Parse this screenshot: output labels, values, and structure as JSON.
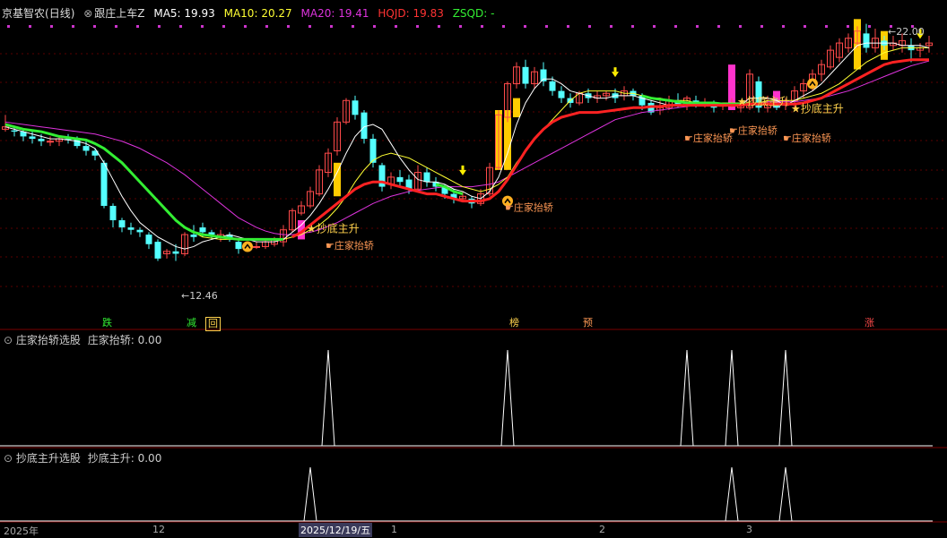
{
  "header": {
    "stock_name": "京基智农",
    "period": "(日线)",
    "indicator": "跟庄上车Z",
    "ma5_label": "MA5:",
    "ma5_value": "19.93",
    "ma10_label": "MA10:",
    "ma10_value": "20.27",
    "ma20_label": "MA20:",
    "ma20_value": "19.41",
    "hqjd_label": "HQJD:",
    "hqjd_value": "19.83",
    "zsqd_label": "ZSQD:",
    "zsqd_value": "-"
  },
  "price_labels": {
    "high": "22.00",
    "low": "12.46"
  },
  "signals": {
    "zhuangjia": "庄家抬轿",
    "chaodi": "抄底主升"
  },
  "bottom_tags": [
    "跌",
    "减",
    "回",
    "榜",
    "预",
    "涨"
  ],
  "panel2": {
    "title": "庄家抬轿选股",
    "series_label": "庄家抬轿:",
    "value": "0.00"
  },
  "panel3": {
    "title": "抄底主升选股",
    "series_label": "抄底主升:",
    "value": "0.00"
  },
  "date_axis": {
    "left": "2025年",
    "month_12": "12",
    "cursor_date": "2025/12/19/五",
    "month_1": "1",
    "mark_a": "2",
    "mark_b": "3"
  },
  "colors": {
    "bg": "#000000",
    "up": "#ff4a4a",
    "down": "#54ffff",
    "ma5": "#ffffff",
    "ma10": "#ffff33",
    "ma20": "#dd33dd",
    "hqjd": "#ff2222",
    "green_line": "#33ee33",
    "signal_gold": "#ffd24d"
  },
  "chart_data": {
    "type": "candlestick",
    "ylim": [
      11.5,
      23.5
    ],
    "candles": [
      [
        19.0,
        19.1,
        18.9,
        19.6
      ],
      [
        18.95,
        18.9,
        18.7,
        19.1
      ],
      [
        18.9,
        18.7,
        18.5,
        19.0
      ],
      [
        18.7,
        18.6,
        18.4,
        18.9
      ],
      [
        18.6,
        18.5,
        18.3,
        18.8
      ],
      [
        18.5,
        18.5,
        18.3,
        18.7
      ],
      [
        18.5,
        18.6,
        18.3,
        18.7
      ],
      [
        18.6,
        18.55,
        18.4,
        18.8
      ],
      [
        18.6,
        18.3,
        18.2,
        18.7
      ],
      [
        18.3,
        18.1,
        17.9,
        18.5
      ],
      [
        18.1,
        17.9,
        17.7,
        18.2
      ],
      [
        17.6,
        15.8,
        15.7,
        17.7
      ],
      [
        15.8,
        15.2,
        14.9,
        15.9
      ],
      [
        15.2,
        14.9,
        14.7,
        15.3
      ],
      [
        14.9,
        14.8,
        14.6,
        15.1
      ],
      [
        14.8,
        14.7,
        14.5,
        14.9
      ],
      [
        14.6,
        14.2,
        14.0,
        14.7
      ],
      [
        14.3,
        13.6,
        13.5,
        14.4
      ],
      [
        13.8,
        13.9,
        13.6,
        14.0
      ],
      [
        13.9,
        13.8,
        13.5,
        14.2
      ],
      [
        13.8,
        14.6,
        13.7,
        14.7
      ],
      [
        14.6,
        14.5,
        14.3,
        15.0
      ],
      [
        14.9,
        14.7,
        14.5,
        15.1
      ],
      [
        14.7,
        14.6,
        14.4,
        14.8
      ],
      [
        14.5,
        14.6,
        14.3,
        14.8
      ],
      [
        14.6,
        14.4,
        14.3,
        14.7
      ],
      [
        14.3,
        14.0,
        13.8,
        14.4
      ],
      [
        14.0,
        14.2,
        13.9,
        14.3
      ],
      [
        14.1,
        14.1,
        14.0,
        14.3
      ],
      [
        14.1,
        14.3,
        14.0,
        14.4
      ],
      [
        14.2,
        14.4,
        14.1,
        14.5
      ],
      [
        14.3,
        14.8,
        14.1,
        15.0
      ],
      [
        14.8,
        15.6,
        14.7,
        15.7
      ],
      [
        15.5,
        15.8,
        15.4,
        16.0
      ],
      [
        15.8,
        16.4,
        15.7,
        16.6
      ],
      [
        16.3,
        17.3,
        16.2,
        17.5
      ],
      [
        17.2,
        18.0,
        17.0,
        18.2
      ],
      [
        18.1,
        19.3,
        17.9,
        19.5
      ],
      [
        19.3,
        20.2,
        19.2,
        20.3
      ],
      [
        20.2,
        19.6,
        19.4,
        20.4
      ],
      [
        19.7,
        18.6,
        18.4,
        19.8
      ],
      [
        18.6,
        17.6,
        17.4,
        18.8
      ],
      [
        17.5,
        16.6,
        16.4,
        17.6
      ],
      [
        16.7,
        17.0,
        16.5,
        17.2
      ],
      [
        17.0,
        16.8,
        16.6,
        17.3
      ],
      [
        16.9,
        16.5,
        16.3,
        17.1
      ],
      [
        16.5,
        17.2,
        16.4,
        17.5
      ],
      [
        17.2,
        16.8,
        16.6,
        17.4
      ],
      [
        16.8,
        16.6,
        16.4,
        17.0
      ],
      [
        16.6,
        16.3,
        16.1,
        16.7
      ],
      [
        16.3,
        16.1,
        15.9,
        16.5
      ],
      [
        16.1,
        16.2,
        16.0,
        16.4
      ],
      [
        16.1,
        15.9,
        15.7,
        16.2
      ],
      [
        15.9,
        16.3,
        15.8,
        16.5
      ],
      [
        16.3,
        17.4,
        16.2,
        17.6
      ],
      [
        17.4,
        19.6,
        17.3,
        19.8
      ],
      [
        19.5,
        20.9,
        19.3,
        21.0
      ],
      [
        20.9,
        21.6,
        20.7,
        21.8
      ],
      [
        21.6,
        20.9,
        20.7,
        21.9
      ],
      [
        20.9,
        21.4,
        20.7,
        21.6
      ],
      [
        21.5,
        21.0,
        20.8,
        21.8
      ],
      [
        21.0,
        20.6,
        20.4,
        21.2
      ],
      [
        20.6,
        20.3,
        20.1,
        20.8
      ],
      [
        20.3,
        20.1,
        19.9,
        20.5
      ],
      [
        20.1,
        20.5,
        20.0,
        20.6
      ],
      [
        20.5,
        20.3,
        20.1,
        20.7
      ],
      [
        20.3,
        20.4,
        20.1,
        20.6
      ],
      [
        20.4,
        20.5,
        20.2,
        20.6
      ],
      [
        20.5,
        20.3,
        20.1,
        20.7
      ],
      [
        20.4,
        20.6,
        20.2,
        20.8
      ],
      [
        20.6,
        20.4,
        20.2,
        20.7
      ],
      [
        20.4,
        20.0,
        19.8,
        20.5
      ],
      [
        20.1,
        19.7,
        19.6,
        20.2
      ],
      [
        19.8,
        19.9,
        19.6,
        20.3
      ],
      [
        19.9,
        20.2,
        19.8,
        20.4
      ],
      [
        20.2,
        20.0,
        19.9,
        20.5
      ],
      [
        20.0,
        20.3,
        19.8,
        20.4
      ],
      [
        20.2,
        20.1,
        19.9,
        20.4
      ],
      [
        20.0,
        20.1,
        19.9,
        20.3
      ],
      [
        20.0,
        19.9,
        19.7,
        20.2
      ],
      [
        20.0,
        20.0,
        19.8,
        20.1
      ],
      [
        20.0,
        20.1,
        19.9,
        20.3
      ],
      [
        19.9,
        20.0,
        19.7,
        20.2
      ],
      [
        19.9,
        21.3,
        19.8,
        21.5
      ],
      [
        21.0,
        19.9,
        19.7,
        21.2
      ],
      [
        19.9,
        20.1,
        19.7,
        20.4
      ],
      [
        20.1,
        19.9,
        19.8,
        20.3
      ],
      [
        20.0,
        20.1,
        19.8,
        20.3
      ],
      [
        20.2,
        20.6,
        19.9,
        20.8
      ],
      [
        20.6,
        20.9,
        20.3,
        21.1
      ],
      [
        20.8,
        21.3,
        20.6,
        21.5
      ],
      [
        21.3,
        21.7,
        21.0,
        21.9
      ],
      [
        21.6,
        22.3,
        21.5,
        22.5
      ],
      [
        22.0,
        22.6,
        21.8,
        22.8
      ],
      [
        22.4,
        22.8,
        22.2,
        23.0
      ],
      [
        22.6,
        23.1,
        22.4,
        23.3
      ],
      [
        23.0,
        22.4,
        22.2,
        23.4
      ],
      [
        22.4,
        22.8,
        22.2,
        23.2
      ],
      [
        22.7,
        22.5,
        22.3,
        22.9
      ],
      [
        22.5,
        22.6,
        22.3,
        22.9
      ],
      [
        22.5,
        22.7,
        22.2,
        23.0
      ],
      [
        22.5,
        22.3,
        21.8,
        22.8
      ],
      [
        22.3,
        22.4,
        22.0,
        22.6
      ],
      [
        22.5,
        22.6,
        22.2,
        22.9
      ]
    ],
    "ma5": [
      19.1,
      19.0,
      18.9,
      18.8,
      18.7,
      18.6,
      18.6,
      18.55,
      18.5,
      18.4,
      18.2,
      17.6,
      16.9,
      16.2,
      15.6,
      15.1,
      14.8,
      14.5,
      14.3,
      14.1,
      14.0,
      14.1,
      14.3,
      14.4,
      14.5,
      14.6,
      14.5,
      14.4,
      14.3,
      14.3,
      14.3,
      14.4,
      14.7,
      15.0,
      15.4,
      15.9,
      16.5,
      17.2,
      18.0,
      18.7,
      19.1,
      19.2,
      19.0,
      18.4,
      17.8,
      17.3,
      16.9,
      16.8,
      16.8,
      16.7,
      16.5,
      16.4,
      16.2,
      16.1,
      16.4,
      17.0,
      18.0,
      19.2,
      20.1,
      20.7,
      21.1,
      21.1,
      20.9,
      20.6,
      20.5,
      20.4,
      20.3,
      20.3,
      20.4,
      20.4,
      20.4,
      20.3,
      20.2,
      20.1,
      20.0,
      20.0,
      20.0,
      20.1,
      20.1,
      20.1,
      20.0,
      20.0,
      20.0,
      20.3,
      20.3,
      20.3,
      20.2,
      20.0,
      20.2,
      20.4,
      20.6,
      20.9,
      21.3,
      21.7,
      22.1,
      22.5,
      22.6,
      22.6,
      22.6,
      22.6,
      22.5,
      22.5,
      22.5,
      22.4
    ],
    "ma10": [
      19.2,
      19.1,
      19.0,
      18.95,
      18.9,
      18.8,
      18.7,
      18.65,
      18.6,
      18.55,
      18.4,
      18.2,
      17.9,
      17.6,
      17.2,
      16.8,
      16.4,
      16.0,
      15.6,
      15.2,
      14.9,
      14.7,
      14.5,
      14.45,
      14.4,
      14.4,
      14.4,
      14.4,
      14.4,
      14.4,
      14.4,
      14.4,
      14.5,
      14.6,
      14.8,
      15.0,
      15.3,
      15.7,
      16.2,
      16.8,
      17.3,
      17.7,
      17.9,
      18.0,
      17.9,
      17.8,
      17.6,
      17.4,
      17.2,
      17.0,
      16.8,
      16.6,
      16.5,
      16.4,
      16.5,
      16.7,
      17.0,
      17.6,
      18.1,
      18.6,
      19.0,
      19.4,
      19.8,
      20.2,
      20.5,
      20.6,
      20.6,
      20.6,
      20.6,
      20.5,
      20.5,
      20.4,
      20.3,
      20.3,
      20.2,
      20.2,
      20.2,
      20.1,
      20.1,
      20.1,
      20.1,
      20.1,
      20.1,
      20.1,
      20.1,
      20.2,
      20.2,
      20.2,
      20.2,
      20.3,
      20.4,
      20.5,
      20.7,
      20.9,
      21.2,
      21.5,
      21.8,
      22.0,
      22.2,
      22.3,
      22.4,
      22.4,
      22.4,
      22.4
    ],
    "ma20": [
      19.3,
      19.25,
      19.2,
      19.15,
      19.1,
      19.05,
      19.0,
      18.95,
      18.9,
      18.85,
      18.8,
      18.7,
      18.6,
      18.5,
      18.35,
      18.2,
      18.0,
      17.8,
      17.6,
      17.35,
      17.1,
      16.8,
      16.5,
      16.2,
      15.9,
      15.6,
      15.3,
      15.1,
      14.9,
      14.75,
      14.65,
      14.6,
      14.6,
      14.65,
      14.7,
      14.8,
      14.95,
      15.1,
      15.3,
      15.5,
      15.7,
      15.9,
      16.05,
      16.2,
      16.3,
      16.4,
      16.45,
      16.5,
      16.55,
      16.6,
      16.6,
      16.6,
      16.6,
      16.65,
      16.7,
      16.8,
      17.0,
      17.2,
      17.4,
      17.6,
      17.8,
      18.0,
      18.2,
      18.4,
      18.6,
      18.8,
      19.0,
      19.2,
      19.4,
      19.5,
      19.6,
      19.7,
      19.75,
      19.8,
      19.85,
      19.9,
      19.95,
      20.0,
      20.0,
      20.05,
      20.05,
      20.1,
      20.1,
      20.1,
      20.1,
      20.15,
      20.15,
      20.15,
      20.15,
      20.2,
      20.25,
      20.3,
      20.4,
      20.5,
      20.6,
      20.75,
      20.9,
      21.05,
      21.2,
      21.35,
      21.5,
      21.65,
      21.75,
      21.85
    ],
    "hqjd": [
      null,
      null,
      null,
      null,
      null,
      null,
      null,
      null,
      null,
      null,
      null,
      null,
      null,
      null,
      null,
      null,
      null,
      null,
      null,
      null,
      null,
      null,
      null,
      null,
      null,
      null,
      null,
      null,
      null,
      null,
      null,
      null,
      14.5,
      14.7,
      15.0,
      15.3,
      15.6,
      15.9,
      16.2,
      16.5,
      16.7,
      16.8,
      16.8,
      16.7,
      16.6,
      16.5,
      16.4,
      16.3,
      16.3,
      16.2,
      16.1,
      16.0,
      16.0,
      16.0,
      16.1,
      16.4,
      16.9,
      17.5,
      18.1,
      18.6,
      19.0,
      19.3,
      19.5,
      19.6,
      19.7,
      19.7,
      19.7,
      19.75,
      19.8,
      19.85,
      19.9,
      19.9,
      19.95,
      19.95,
      20.0,
      20.0,
      20.0,
      20.0,
      20.0,
      20.0,
      20.0,
      20.0,
      20.0,
      20.05,
      20.05,
      20.05,
      20.05,
      20.05,
      20.05,
      20.1,
      20.2,
      20.3,
      20.5,
      20.7,
      20.9,
      21.1,
      21.3,
      21.5,
      21.7,
      21.8,
      21.85,
      21.9,
      21.9,
      21.9
    ],
    "green_line": [
      19.2,
      19.1,
      19.0,
      18.95,
      18.9,
      18.8,
      18.7,
      18.65,
      18.6,
      18.55,
      18.4,
      18.2,
      17.9,
      17.6,
      17.2,
      16.8,
      16.4,
      16.0,
      15.6,
      15.2,
      14.9,
      14.7,
      14.6,
      14.55,
      14.5,
      14.45,
      14.4,
      14.4,
      14.4,
      14.4,
      14.4,
      14.4,
      null,
      null,
      null,
      null,
      null,
      null,
      null,
      null,
      null,
      null,
      null,
      null,
      null,
      null,
      null,
      null,
      16.7,
      16.6,
      16.4,
      16.3,
      null,
      null,
      null,
      null,
      null,
      null,
      null,
      null,
      null,
      null,
      null,
      null,
      null,
      null,
      null,
      null,
      null,
      null,
      null,
      20.4,
      20.3,
      20.25,
      20.2,
      20.15,
      20.1,
      20.1,
      20.1,
      20.1,
      20.05,
      20.05,
      20.05,
      20.05,
      20.05,
      20.05,
      null,
      null,
      null,
      null,
      null,
      null,
      null,
      null,
      null,
      null,
      null,
      null,
      null,
      null,
      null,
      null,
      null,
      null
    ],
    "yellow_bars": [
      [
        37,
        16.2,
        17.6
      ],
      [
        55,
        17.3,
        19.8
      ],
      [
        56,
        17.3,
        19.8
      ],
      [
        57,
        19.5,
        20.3
      ],
      [
        95,
        21.5,
        23.6
      ],
      [
        98,
        21.9,
        23.1
      ]
    ],
    "magenta_bars": [
      [
        33,
        14.4,
        15.2
      ],
      [
        81,
        19.8,
        21.7
      ],
      [
        86,
        19.9,
        20.6
      ]
    ],
    "panel2_spikes": [
      36,
      56,
      76,
      81,
      87
    ],
    "panel3_spikes": [
      34,
      81,
      87
    ]
  }
}
